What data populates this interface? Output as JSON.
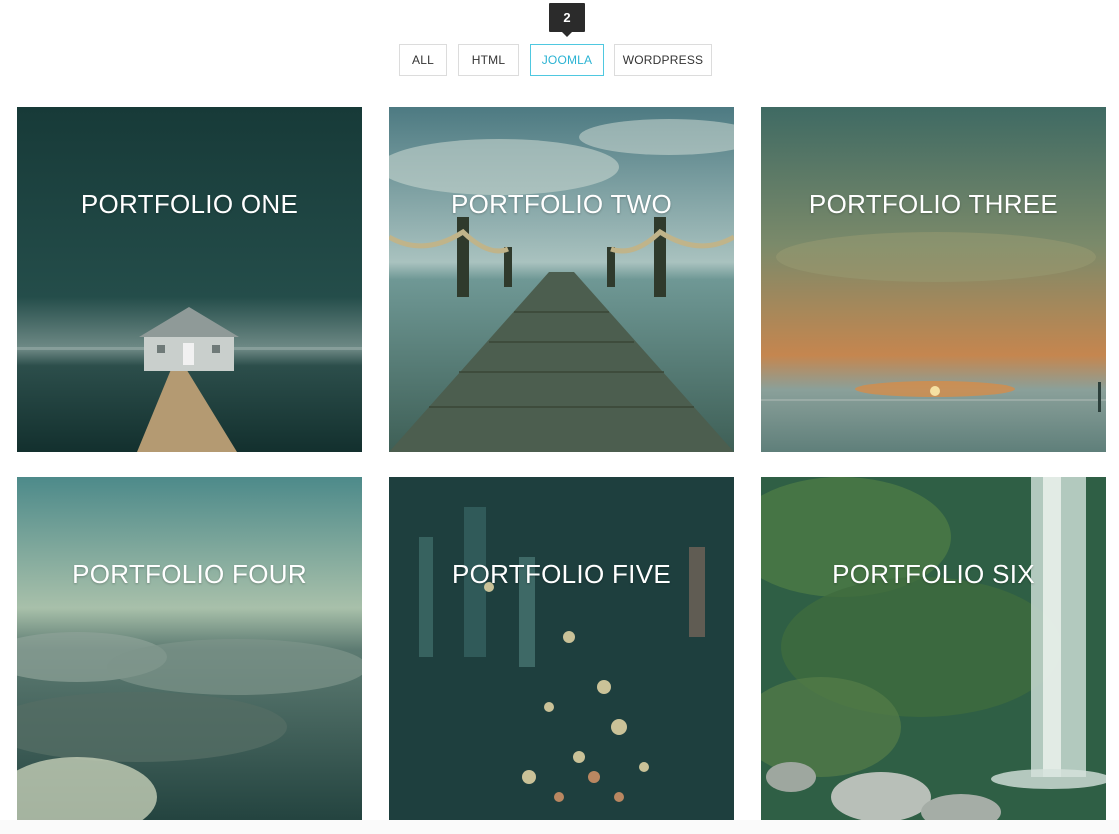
{
  "filters": {
    "all": "ALL",
    "html": "HTML",
    "joomla": "JOOMLA",
    "wordpress": "WORDPRESS",
    "active": "joomla",
    "active_count": "2"
  },
  "portfolio": [
    {
      "title": "PORTFOLIO ONE"
    },
    {
      "title": "PORTFOLIO TWO"
    },
    {
      "title": "PORTFOLIO THREE"
    },
    {
      "title": "PORTFOLIO FOUR"
    },
    {
      "title": "PORTFOLIO FIVE"
    },
    {
      "title": "PORTFOLIO SIX"
    }
  ],
  "colors": {
    "accent": "#4fc8e0",
    "overlay": "#1f4a47"
  }
}
